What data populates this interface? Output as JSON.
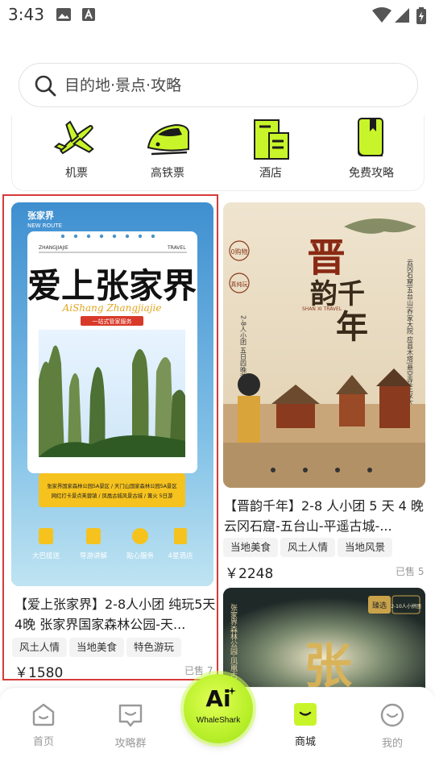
{
  "status_bar": {
    "time": "3:43"
  },
  "search": {
    "placeholder": "目的地·景点·攻略"
  },
  "categories": [
    {
      "label": "机票",
      "icon": "plane-icon"
    },
    {
      "label": "高铁票",
      "icon": "train-icon"
    },
    {
      "label": "酒店",
      "icon": "hotel-icon"
    },
    {
      "label": "免费攻略",
      "icon": "guide-icon"
    }
  ],
  "products": [
    {
      "title": "【爱上张家界】2-8人小团 纯玩5天4晚 张家界国家森林公园-天...",
      "tags": [
        "风土人情",
        "当地美食",
        "特色游玩"
      ],
      "price": "￥1580",
      "sold": "已售 7",
      "poster": {
        "brand": "张家界",
        "brand_sub": "NEW ROUTE",
        "ticket_left": "ZHANGJIAJIE",
        "ticket_right": "TRAVEL",
        "headline": "爱上张家界",
        "script": "AiShang Zhangjiajie",
        "badge": "一站式管家服务",
        "route_line1": "张家界国家森林公园5A景区 / 天门山国家森林公园5A景区",
        "route_line2": "网红打卡景点芙蓉镇 / 凤凰古城风景古城 / 篝火 5日游",
        "services": [
          "大巴接送",
          "导游讲解",
          "贴心服务",
          "4星酒店"
        ]
      }
    },
    {
      "title": "【晋韵千年】2-8 人小团 5 天 4 晚 云冈石窟-五台山-平遥古城-...",
      "tags": [
        "当地美食",
        "风土人情",
        "当地风景"
      ],
      "price": "￥2248",
      "sold": "已售 5",
      "poster": {
        "headline_top": "晋",
        "headline_mid": "韵千",
        "headline_bottom": "年",
        "en": "SHAN XI TRAVEL",
        "badge1": "0购物",
        "badge2": "真纯玩",
        "side_left": "2-8人小团 五日四晚游",
        "side_right": "云冈石窟|五台山|乔家大院 应县木塔|悬空寺|王家大院"
      }
    },
    {
      "poster": {
        "headline": "张",
        "badge_left": "臻选",
        "badge_right": "2-10人小拼团",
        "side_text": "张家界森林公园·凤凰古城"
      }
    }
  ],
  "bottom_nav": {
    "items": [
      {
        "label": "首页",
        "icon": "home-icon"
      },
      {
        "label": "攻略群",
        "icon": "chat-icon"
      },
      {
        "label": "商城",
        "icon": "mall-icon",
        "active": true
      },
      {
        "label": "我的",
        "icon": "profile-icon"
      }
    ],
    "center": {
      "main": "Ai",
      "sub": "WhaleShark"
    }
  },
  "colors": {
    "accent": "#c8f52a",
    "highlight": "#d63a3a",
    "price": "#222222"
  }
}
